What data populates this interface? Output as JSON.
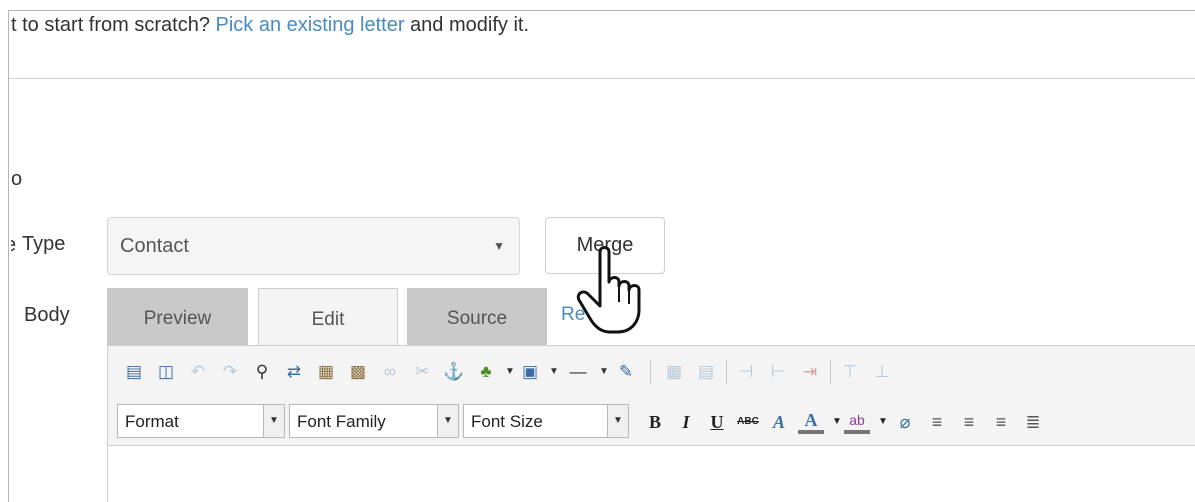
{
  "intro": {
    "prefix": "t to start from scratch? ",
    "link": "Pick an existing letter",
    "suffix": " and modify it."
  },
  "labels": {
    "to_partial": "o",
    "type_partial": "Type",
    "body_partial": "Body"
  },
  "merge_type_select": {
    "value": "Contact"
  },
  "merge_button": {
    "label": "Merge"
  },
  "tabs": [
    {
      "label": "Preview",
      "active": false
    },
    {
      "label": "Edit",
      "active": true
    },
    {
      "label": "Source",
      "active": false
    }
  ],
  "reset_link_partial": "Re",
  "toolbar_dropdowns": {
    "format": "Format",
    "font_family": "Font Family",
    "font_size": "Font Size"
  },
  "format_buttons": {
    "bold": "B",
    "italic": "I",
    "underline": "U",
    "strike": "ABC",
    "font_color": "A"
  },
  "colors": {
    "link": "#4a8bc2",
    "tab_inactive": "#c9c9c9",
    "tab_active": "#f4f4f4",
    "toolbar_bg": "#f4f4f4",
    "icon_blue": "#3a6ea5"
  },
  "toolbar_icons": [
    "new-document-icon",
    "template-icon",
    "undo-icon",
    "redo-icon",
    "find-icon",
    "replace-icon",
    "paste-icon",
    "paste-word-icon",
    "link-icon",
    "unlink-icon",
    "anchor-icon",
    "image-icon",
    "media-icon",
    "horizontal-rule-icon",
    "edit-icon",
    "table-icon",
    "table-props-icon",
    "insert-col-before-icon",
    "insert-col-after-icon",
    "delete-col-icon",
    "insert-row-before-icon"
  ]
}
